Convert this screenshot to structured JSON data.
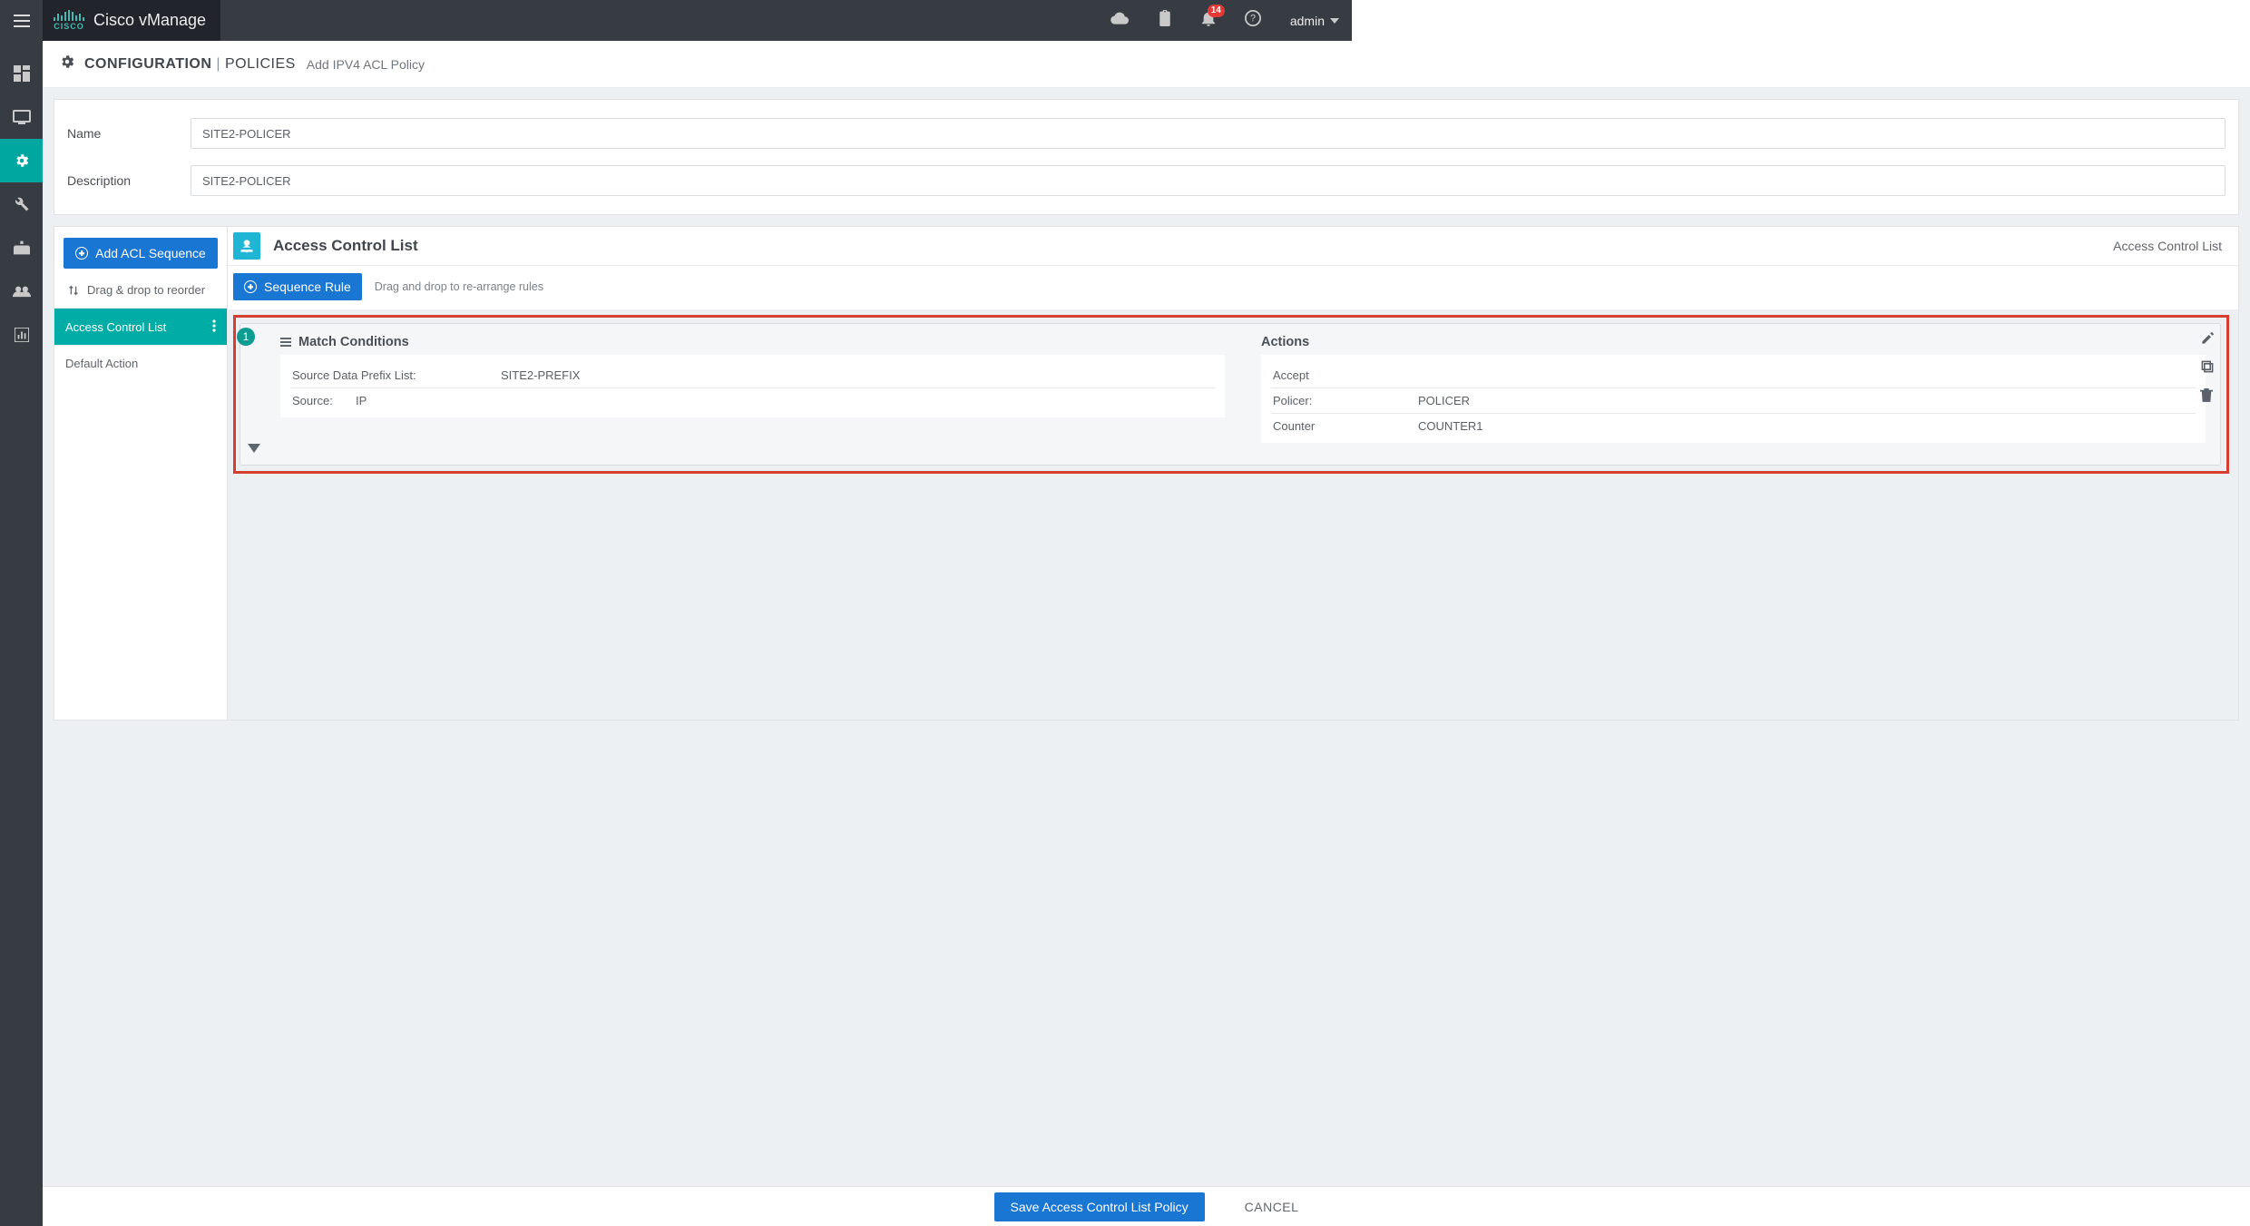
{
  "header": {
    "app_title": "Cisco vManage",
    "notifications_count": "14",
    "user": "admin"
  },
  "breadcrumb": {
    "section": "CONFIGURATION",
    "subsection": "POLICIES",
    "page": "Add IPV4 ACL Policy"
  },
  "form": {
    "name_label": "Name",
    "name_value": "SITE2-POLICER",
    "description_label": "Description",
    "description_value": "SITE2-POLICER"
  },
  "sidepanel": {
    "add_button": "Add ACL Sequence",
    "drag_hint": "Drag & drop to reorder",
    "items": [
      {
        "label": "Access Control List",
        "active": true
      },
      {
        "label": "Default Action",
        "active": false
      }
    ]
  },
  "rule_header": {
    "title": "Access Control List",
    "right_label": "Access Control List"
  },
  "toolbar": {
    "sequence_btn": "Sequence Rule",
    "hint": "Drag and drop to re-arrange rules"
  },
  "rule": {
    "number": "1",
    "match_title": "Match Conditions",
    "actions_title": "Actions",
    "match": [
      {
        "label": "Source Data Prefix List:",
        "value": "SITE2-PREFIX"
      },
      {
        "label": "Source:",
        "value": "IP"
      }
    ],
    "actions": [
      {
        "label": "Accept",
        "value": ""
      },
      {
        "label": "Policer:",
        "value": "POLICER"
      },
      {
        "label": "Counter",
        "value": "COUNTER1"
      }
    ]
  },
  "footer": {
    "save": "Save Access Control List Policy",
    "cancel": "CANCEL"
  }
}
